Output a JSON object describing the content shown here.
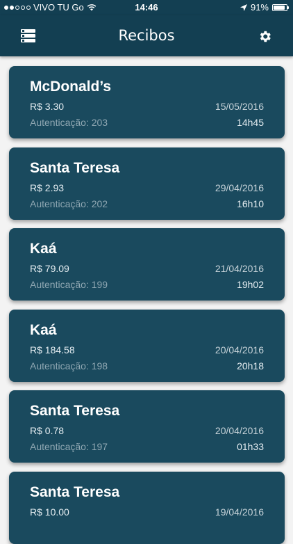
{
  "status": {
    "carrier": "VIVO TU Go",
    "time": "14:46",
    "battery": "91%",
    "battery_level": 0.91
  },
  "nav": {
    "title": "Recibos"
  },
  "receipts": [
    {
      "name": "McDonald’s",
      "amount": "R$ 3.30",
      "auth": "Autenticação: 203",
      "date": "15/05/2016",
      "time": "14h45"
    },
    {
      "name": "Santa Teresa",
      "amount": "R$ 2.93",
      "auth": "Autenticação: 202",
      "date": "29/04/2016",
      "time": "16h10"
    },
    {
      "name": "Kaá",
      "amount": "R$ 79.09",
      "auth": "Autenticação: 199",
      "date": "21/04/2016",
      "time": "19h02"
    },
    {
      "name": "Kaá",
      "amount": "R$ 184.58",
      "auth": "Autenticação: 198",
      "date": "20/04/2016",
      "time": "20h18"
    },
    {
      "name": "Santa Teresa",
      "amount": "R$ 0.78",
      "auth": "Autenticação: 197",
      "date": "20/04/2016",
      "time": "01h33"
    },
    {
      "name": "Santa Teresa",
      "amount": "R$ 10.00",
      "auth": "",
      "date": "19/04/2016",
      "time": ""
    }
  ]
}
